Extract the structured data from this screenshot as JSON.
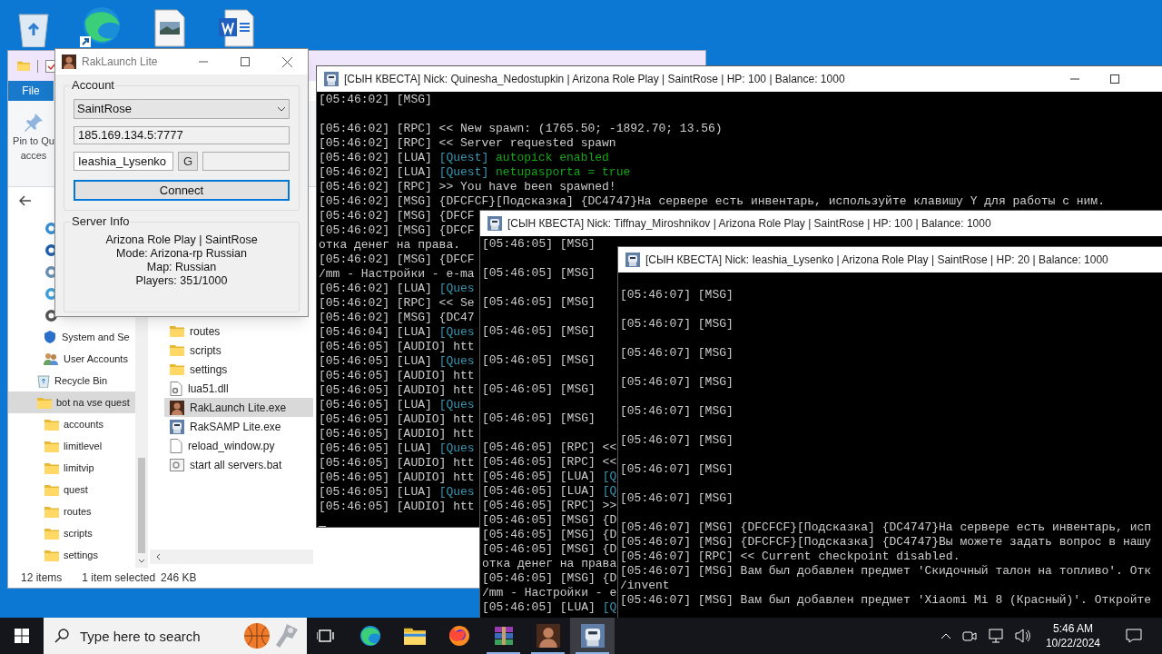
{
  "explorer": {
    "file_tab": "File",
    "pin_label_lines": [
      "Pin to Qu",
      "acces"
    ],
    "control_panel_items": [
      {
        "label": "System and Se",
        "kind": "shield"
      },
      {
        "label": "User Accounts",
        "kind": "users"
      }
    ],
    "nav_items": [
      {
        "label": "Recycle Bin",
        "kind": "recycle",
        "selected": false
      },
      {
        "label": "bot na vse quest",
        "kind": "folder",
        "selected": true,
        "children": [
          {
            "label": "accounts",
            "kind": "folder",
            "selected": false
          },
          {
            "label": "limitlevel",
            "kind": "folder",
            "selected": false
          },
          {
            "label": "limitvip",
            "kind": "folder",
            "selected": false
          },
          {
            "label": "quest",
            "kind": "folder",
            "selected": false
          },
          {
            "label": "routes",
            "kind": "folder",
            "selected": false
          },
          {
            "label": "scripts",
            "kind": "folder",
            "selected": false
          },
          {
            "label": "settings",
            "kind": "folder",
            "selected": false
          }
        ]
      }
    ],
    "files": [
      {
        "name": "routes",
        "kind": "folder",
        "selected": false
      },
      {
        "name": "scripts",
        "kind": "folder",
        "selected": false
      },
      {
        "name": "settings",
        "kind": "folder",
        "selected": false
      },
      {
        "name": "lua51.dll",
        "kind": "dll",
        "selected": false
      },
      {
        "name": "RakLaunch Lite.exe",
        "kind": "portrait",
        "selected": true
      },
      {
        "name": "RakSAMP Lite.exe",
        "kind": "robot",
        "selected": false
      },
      {
        "name": "reload_window.py",
        "kind": "document",
        "selected": false
      },
      {
        "name": "start all servers.bat",
        "kind": "batch",
        "selected": false
      }
    ],
    "status_bar": {
      "item_count": "12 items",
      "selection": "1 item selected",
      "size": "246 KB"
    }
  },
  "launcher": {
    "title": "RakLaunch Lite",
    "account_group": "Account",
    "server_select": "SaintRose",
    "address": "185.169.134.5:7777",
    "nickname": "Ieashia_Lysenko",
    "generate_button": "G",
    "connect_button": "Connect",
    "server_info_group": "Server Info",
    "server_info": [
      "Arizona Role Play | SaintRose",
      "Mode: Arizona-rp Russian",
      "Map: Russian",
      "Players: 351/1000"
    ]
  },
  "consoles": [
    {
      "title": "[СЫН КВЕСТА] Nick: Quinesha_Nedostupkin | Arizona Role Play | SaintRose | HP: 100 | Balance: 1000",
      "cursor": true,
      "lines": [
        {
          "segments": [
            {
              "text": "[05:46:02] [MSG]",
              "kind": "plain"
            }
          ],
          "blank_after": true
        },
        {
          "segments": [
            {
              "text": "[05:46:02] [RPC] << New spawn: (1765.50; -1892.70; 13.56)",
              "kind": "plain"
            }
          ]
        },
        {
          "segments": [
            {
              "text": "[05:46:02] [RPC] << Server requested spawn",
              "kind": "plain"
            }
          ]
        },
        {
          "segments": [
            {
              "text": "[05:46:02] [LUA] ",
              "kind": "plain"
            },
            {
              "text": "[Quest]",
              "kind": "tag"
            },
            {
              "text": " autopick enabled",
              "kind": "value"
            }
          ]
        },
        {
          "segments": [
            {
              "text": "[05:46:02] [LUA] ",
              "kind": "plain"
            },
            {
              "text": "[Quest]",
              "kind": "tag"
            },
            {
              "text": " netupasporta = true",
              "kind": "value"
            }
          ]
        },
        {
          "segments": [
            {
              "text": "[05:46:02] [RPC] >> You have been spawned!",
              "kind": "plain"
            }
          ]
        },
        {
          "segments": [
            {
              "text": "[05:46:02] [MSG] {DFCFCF}[Подсказка] {DC4747}На сервере есть инвентарь, используйте клавишу Y для работы с ним.",
              "kind": "plain"
            }
          ]
        },
        {
          "segments": [
            {
              "text": "[05:46:02] [MSG] {DFCF",
              "kind": "plain"
            }
          ]
        },
        {
          "segments": [
            {
              "text": "[05:46:02] [MSG] {DFCF",
              "kind": "plain"
            }
          ]
        },
        {
          "segments": [
            {
              "text": "отка денег на права.",
              "kind": "plain"
            }
          ]
        },
        {
          "segments": [
            {
              "text": "[05:46:02] [MSG] {DFCF",
              "kind": "plain"
            }
          ]
        },
        {
          "segments": [
            {
              "text": "/mm - Настройки - e-ma",
              "kind": "plain"
            }
          ]
        },
        {
          "segments": [
            {
              "text": "[05:46:02] [LUA] ",
              "kind": "plain"
            },
            {
              "text": "[Ques",
              "kind": "tag"
            }
          ]
        },
        {
          "segments": [
            {
              "text": "[05:46:02] [RPC] << Se",
              "kind": "plain"
            }
          ]
        },
        {
          "segments": [
            {
              "text": "[05:46:02] [MSG] {DC47",
              "kind": "plain"
            }
          ]
        },
        {
          "segments": [
            {
              "text": "[05:46:04] [LUA] ",
              "kind": "plain"
            },
            {
              "text": "[Ques",
              "kind": "tag"
            }
          ]
        },
        {
          "segments": [
            {
              "text": "[05:46:05] [AUDIO] htt",
              "kind": "plain"
            }
          ]
        },
        {
          "segments": [
            {
              "text": "[05:46:05] [LUA] ",
              "kind": "plain"
            },
            {
              "text": "[Ques",
              "kind": "tag"
            }
          ]
        },
        {
          "segments": [
            {
              "text": "[05:46:05] [AUDIO] htt",
              "kind": "plain"
            }
          ]
        },
        {
          "segments": [
            {
              "text": "[05:46:05] [AUDIO] htt",
              "kind": "plain"
            }
          ]
        },
        {
          "segments": [
            {
              "text": "[05:46:05] [LUA] ",
              "kind": "plain"
            },
            {
              "text": "[Ques",
              "kind": "tag"
            }
          ]
        },
        {
          "segments": [
            {
              "text": "[05:46:05] [AUDIO] htt",
              "kind": "plain"
            }
          ]
        },
        {
          "segments": [
            {
              "text": "[05:46:05] [AUDIO] htt",
              "kind": "plain"
            }
          ]
        },
        {
          "segments": [
            {
              "text": "[05:46:05] [LUA] ",
              "kind": "plain"
            },
            {
              "text": "[Ques",
              "kind": "tag"
            }
          ]
        },
        {
          "segments": [
            {
              "text": "[05:46:05] [AUDIO] htt",
              "kind": "plain"
            }
          ]
        },
        {
          "segments": [
            {
              "text": "[05:46:05] [AUDIO] htt",
              "kind": "plain"
            }
          ]
        },
        {
          "segments": [
            {
              "text": "[05:46:05] [LUA] ",
              "kind": "plain"
            },
            {
              "text": "[Ques",
              "kind": "tag"
            }
          ]
        },
        {
          "segments": [
            {
              "text": "[05:46:05] [AUDIO] htt",
              "kind": "plain"
            }
          ]
        }
      ]
    },
    {
      "title": "[СЫН КВЕСТА] Nick: Tiffnay_Miroshnikov | Arizona Role Play | SaintRose | HP: 100 | Balance: 1000",
      "lines": [
        {
          "segments": [
            {
              "text": "[05:46:05] [MSG]",
              "kind": "plain"
            }
          ],
          "blank_after": true
        },
        {
          "segments": [
            {
              "text": "[05:46:05] [MSG]",
              "kind": "plain"
            }
          ],
          "blank_after": true
        },
        {
          "segments": [
            {
              "text": "[05:46:05] [MSG]",
              "kind": "plain"
            }
          ],
          "blank_after": true
        },
        {
          "segments": [
            {
              "text": "[05:46:05] [MSG]",
              "kind": "plain"
            }
          ],
          "blank_after": true
        },
        {
          "segments": [
            {
              "text": "[05:46:05] [MSG]",
              "kind": "plain"
            }
          ],
          "blank_after": true
        },
        {
          "segments": [
            {
              "text": "[05:46:05] [MSG]",
              "kind": "plain"
            }
          ],
          "blank_after": true
        },
        {
          "segments": [
            {
              "text": "[05:46:05] [MSG]",
              "kind": "plain"
            }
          ],
          "blank_after": true
        },
        {
          "segments": [
            {
              "text": "[05:46:05] [RPC] <<",
              "kind": "plain"
            }
          ]
        },
        {
          "segments": [
            {
              "text": "[05:46:05] [RPC] <<",
              "kind": "plain"
            }
          ]
        },
        {
          "segments": [
            {
              "text": "[05:46:05] [LUA] ",
              "kind": "plain"
            },
            {
              "text": "[Q",
              "kind": "tag"
            }
          ]
        },
        {
          "segments": [
            {
              "text": "[05:46:05] [LUA] ",
              "kind": "plain"
            },
            {
              "text": "[Q",
              "kind": "tag"
            }
          ]
        },
        {
          "segments": [
            {
              "text": "[05:46:05] [RPC] >>",
              "kind": "plain"
            }
          ]
        },
        {
          "segments": [
            {
              "text": "[05:46:05] [MSG] {D",
              "kind": "plain"
            }
          ]
        },
        {
          "segments": [
            {
              "text": "[05:46:05] [MSG] {D",
              "kind": "plain"
            }
          ]
        },
        {
          "segments": [
            {
              "text": "[05:46:05] [MSG] {D",
              "kind": "plain"
            }
          ]
        },
        {
          "segments": [
            {
              "text": "отка денег на права",
              "kind": "plain"
            }
          ]
        },
        {
          "segments": [
            {
              "text": "[05:46:05] [MSG] {D",
              "kind": "plain"
            }
          ]
        },
        {
          "segments": [
            {
              "text": "/mm - Настройки - e",
              "kind": "plain"
            }
          ]
        },
        {
          "segments": [
            {
              "text": "[05:46:05] [LUA] ",
              "kind": "plain"
            },
            {
              "text": "[Q",
              "kind": "tag"
            }
          ]
        }
      ]
    },
    {
      "title": "[СЫН КВЕСТА] Nick: Ieashia_Lysenko | Arizona Role Play | SaintRose | HP: 20 | Balance: 1000",
      "lines": [
        {
          "segments": [
            {
              "text": "[05:46:07] [MSG]",
              "kind": "plain"
            }
          ],
          "blank_before": true
        },
        {
          "segments": [
            {
              "text": "[05:46:07] [MSG]",
              "kind": "plain"
            }
          ],
          "blank_before": true
        },
        {
          "segments": [
            {
              "text": "[05:46:07] [MSG]",
              "kind": "plain"
            }
          ],
          "blank_before": true
        },
        {
          "segments": [
            {
              "text": "[05:46:07] [MSG]",
              "kind": "plain"
            }
          ],
          "blank_before": true
        },
        {
          "segments": [
            {
              "text": "[05:46:07] [MSG]",
              "kind": "plain"
            }
          ],
          "blank_before": true
        },
        {
          "segments": [
            {
              "text": "[05:46:07] [MSG]",
              "kind": "plain"
            }
          ],
          "blank_before": true
        },
        {
          "segments": [
            {
              "text": "[05:46:07] [MSG]",
              "kind": "plain"
            }
          ],
          "blank_before": true
        },
        {
          "segments": [
            {
              "text": "[05:46:07] [MSG]",
              "kind": "plain"
            }
          ],
          "blank_before": true,
          "blank_after": true
        },
        {
          "segments": [
            {
              "text": "[05:46:07] [MSG] {DFCFCF}[Подсказка] {DC4747}На сервере есть инвентарь, исп",
              "kind": "plain"
            }
          ]
        },
        {
          "segments": [
            {
              "text": "[05:46:07] [MSG] {DFCFCF}[Подсказка] {DC4747}Вы можете задать вопрос в нашу",
              "kind": "plain"
            }
          ]
        },
        {
          "segments": [
            {
              "text": "[05:46:07] [RPC] << Current checkpoint disabled.",
              "kind": "plain"
            }
          ]
        },
        {
          "segments": [
            {
              "text": "[05:46:07] [MSG] Вам был добавлен предмет 'Скидочный талон на топливо'. Отк",
              "kind": "plain"
            }
          ]
        },
        {
          "segments": [
            {
              "text": "/invent",
              "kind": "plain"
            }
          ]
        },
        {
          "segments": [
            {
              "text": "[05:46:07] [MSG] Вам был добавлен предмет 'Xiaomi Mi 8 (Красный)'. Откройте",
              "kind": "plain"
            }
          ]
        }
      ]
    }
  ],
  "taskbar": {
    "search_placeholder": "Type here to search",
    "apps": [
      {
        "kind": "task_view",
        "running": false,
        "selected": false
      },
      {
        "kind": "browser",
        "running": false,
        "selected": false
      },
      {
        "kind": "folder",
        "running": false,
        "selected": false
      },
      {
        "kind": "firefox",
        "running": false,
        "selected": false
      },
      {
        "kind": "archive",
        "running": true,
        "selected": false
      },
      {
        "kind": "portrait",
        "running": true,
        "selected": false
      },
      {
        "kind": "robot",
        "running": true,
        "selected": true
      }
    ],
    "time": "5:46 AM",
    "date": "10/22/2024"
  }
}
